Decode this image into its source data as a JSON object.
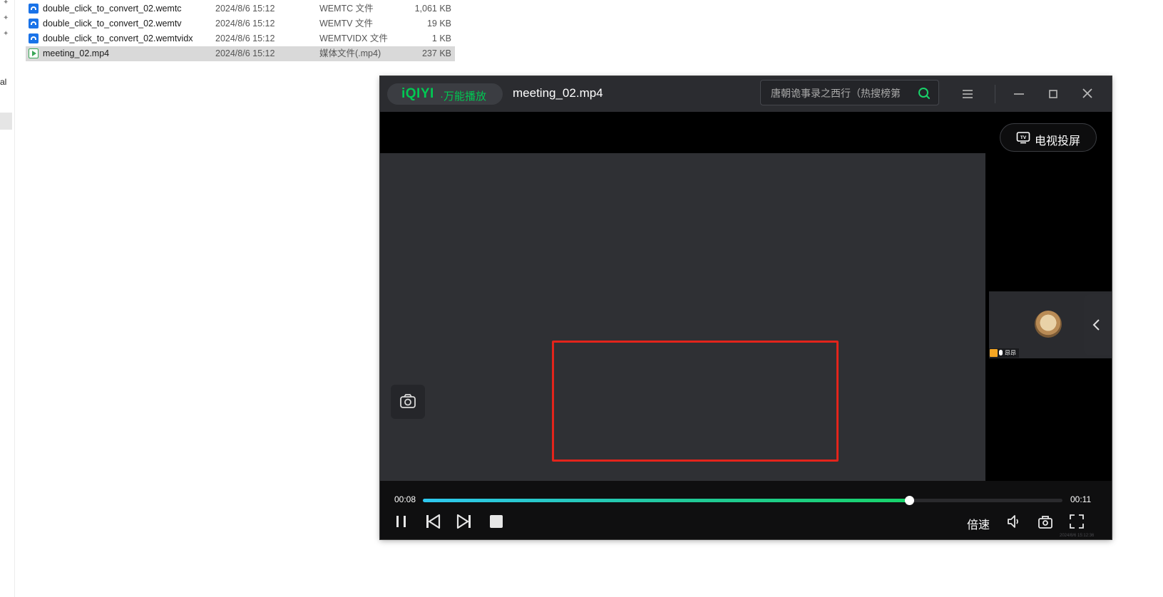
{
  "explorer": {
    "side_label": "al",
    "files": [
      {
        "name": "double_click_to_convert_02.wemtc",
        "date": "2024/8/6 15:12",
        "type": "WEMTC 文件",
        "size": "1,061 KB",
        "icon": "wem-file-icon",
        "selected": false
      },
      {
        "name": "double_click_to_convert_02.wemtv",
        "date": "2024/8/6 15:12",
        "type": "WEMTV 文件",
        "size": "19 KB",
        "icon": "wem-file-icon",
        "selected": false
      },
      {
        "name": "double_click_to_convert_02.wemtvidx",
        "date": "2024/8/6 15:12",
        "type": "WEMTVIDX 文件",
        "size": "1 KB",
        "icon": "wem-file-icon",
        "selected": false
      },
      {
        "name": "meeting_02.mp4",
        "date": "2024/8/6 15:12",
        "type": "媒体文件(.mp4)",
        "size": "237 KB",
        "icon": "video-file-icon",
        "selected": true
      }
    ]
  },
  "player": {
    "logo_brand": "iQIYI",
    "logo_sub": "·万能播放",
    "title": "meeting_02.mp4",
    "search_placeholder": "唐朝诡事录之西行（热搜榜第",
    "cast_label": "电视投屏",
    "participant_badge": "昂昂",
    "time_current": "00:08",
    "time_total": "00:11",
    "progress_fraction": 0.76,
    "speed_label": "倍速",
    "watermark": "2024/8/6 15:12:36",
    "colors": {
      "brand": "#00c853",
      "annotation_box": "#e3241b",
      "progress_start": "#2ec8f0",
      "progress_end": "#18d36a"
    }
  }
}
